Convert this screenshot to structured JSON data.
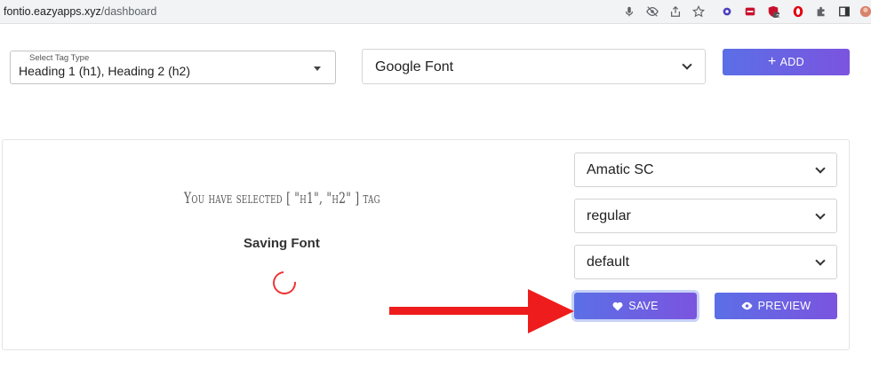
{
  "browser": {
    "url_domain": "fontio.eazyapps.xyz",
    "url_path": "/dashboard",
    "toolbar_icons": [
      "microphone-icon",
      "eye-off-icon",
      "share-icon",
      "star-icon",
      "extension-gear-icon",
      "extension-red-icon",
      "extension-shield-icon",
      "opera-icon",
      "puzzle-icon",
      "sidebar-icon",
      "profile-avatar"
    ],
    "extension_badge": "2"
  },
  "top": {
    "tag_select": {
      "label": "Select Tag Type",
      "value": "Heading 1 (h1), Heading 2 (h2)"
    },
    "font_source": {
      "value": "Google Font"
    },
    "add_button": {
      "label": "ADD"
    }
  },
  "preview": {
    "selected_text": "You have selected [ \"h1\", \"h2\" ] tag",
    "status": "Saving Font"
  },
  "options": {
    "font_family": "Amatic SC",
    "font_weight": "regular",
    "font_style": "default"
  },
  "actions": {
    "save_label": "SAVE",
    "preview_label": "PREVIEW"
  },
  "colors": {
    "button_gradient_start": "#5b6fe6",
    "button_gradient_end": "#7b54df",
    "spinner": "#ee3333",
    "arrow": "#ee1c1c"
  }
}
